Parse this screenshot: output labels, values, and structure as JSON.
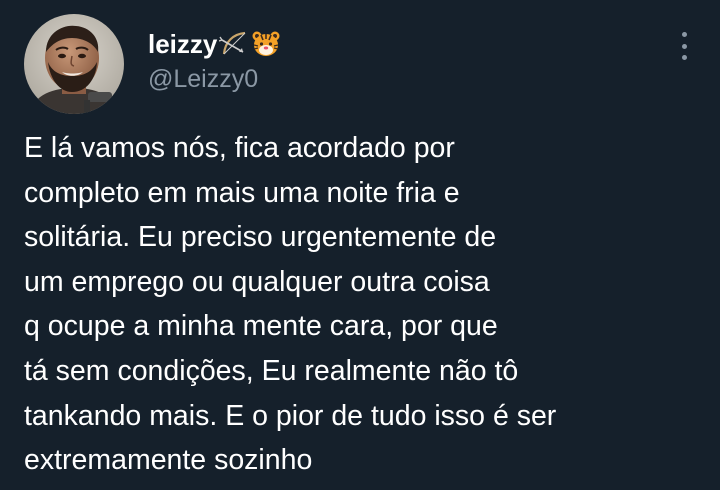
{
  "tweet": {
    "author": {
      "display_name": "leizzy",
      "handle": "@Leizzy0",
      "name_emojis": [
        "bow-and-arrow-emoji",
        "tiger-face-emoji"
      ]
    },
    "text_lines": [
      "E lá vamos nós, fica acordado por",
      "completo em mais uma noite fria e",
      "solitária. Eu preciso urgentemente de",
      "um emprego ou qualquer outra coisa",
      "q ocupe a minha mente cara, por que",
      "tá sem condições, Eu realmente não tô",
      "tankando mais. E o pior de tudo isso é ser",
      "extremamente sozinho"
    ]
  },
  "colors": {
    "background": "#15202b",
    "text_primary": "#ffffff",
    "text_secondary": "#8b98a5"
  },
  "icons": {
    "more_menu": "more-vertical-icon"
  }
}
